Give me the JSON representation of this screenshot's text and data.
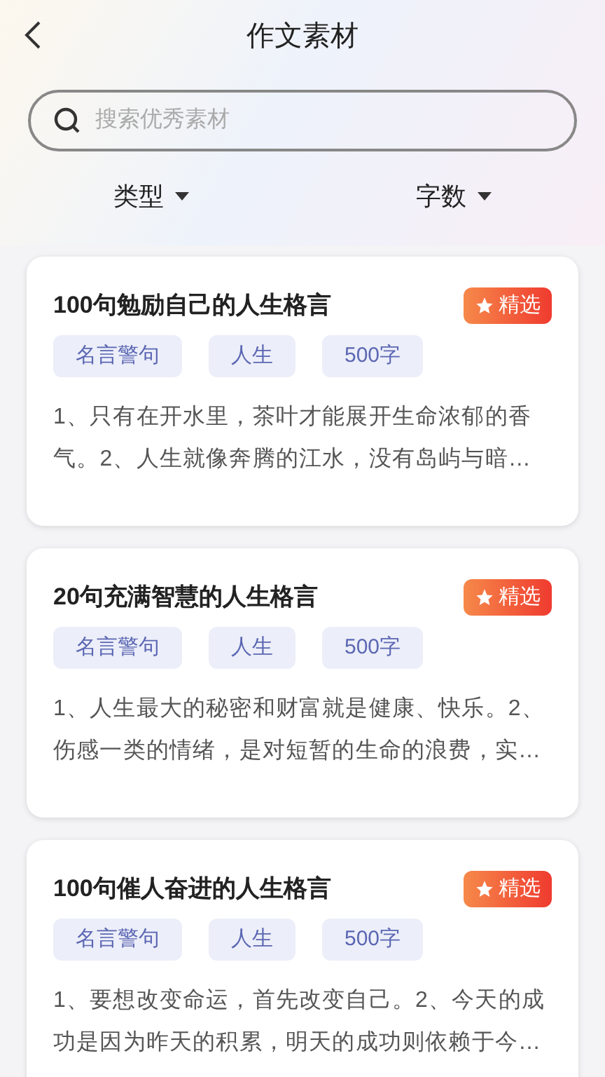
{
  "header": {
    "title": "作文素材"
  },
  "search": {
    "placeholder": "搜索优秀素材"
  },
  "filters": [
    {
      "label": "类型"
    },
    {
      "label": "字数"
    }
  ],
  "cards": [
    {
      "title": "100句勉励自己的人生格言",
      "badge": "精选",
      "tags": [
        "名言警句",
        "人生",
        "500字"
      ],
      "excerpt": "1、只有在开水里，茶叶才能展开生命浓郁的香气。2、人生就像奔腾的江水，没有岛屿与暗…"
    },
    {
      "title": "20句充满智慧的人生格言",
      "badge": "精选",
      "tags": [
        "名言警句",
        "人生",
        "500字"
      ],
      "excerpt": "1、人生最大的秘密和财富就是健康、快乐。2、伤感一类的情绪，是对短暂的生命的浪费，实…"
    },
    {
      "title": "100句催人奋进的人生格言",
      "badge": "精选",
      "tags": [
        "名言警句",
        "人生",
        "500字"
      ],
      "excerpt": "1、要想改变命运，首先改变自己。2、今天的成功是因为昨天的积累，明天的成功则依赖于今…"
    }
  ]
}
